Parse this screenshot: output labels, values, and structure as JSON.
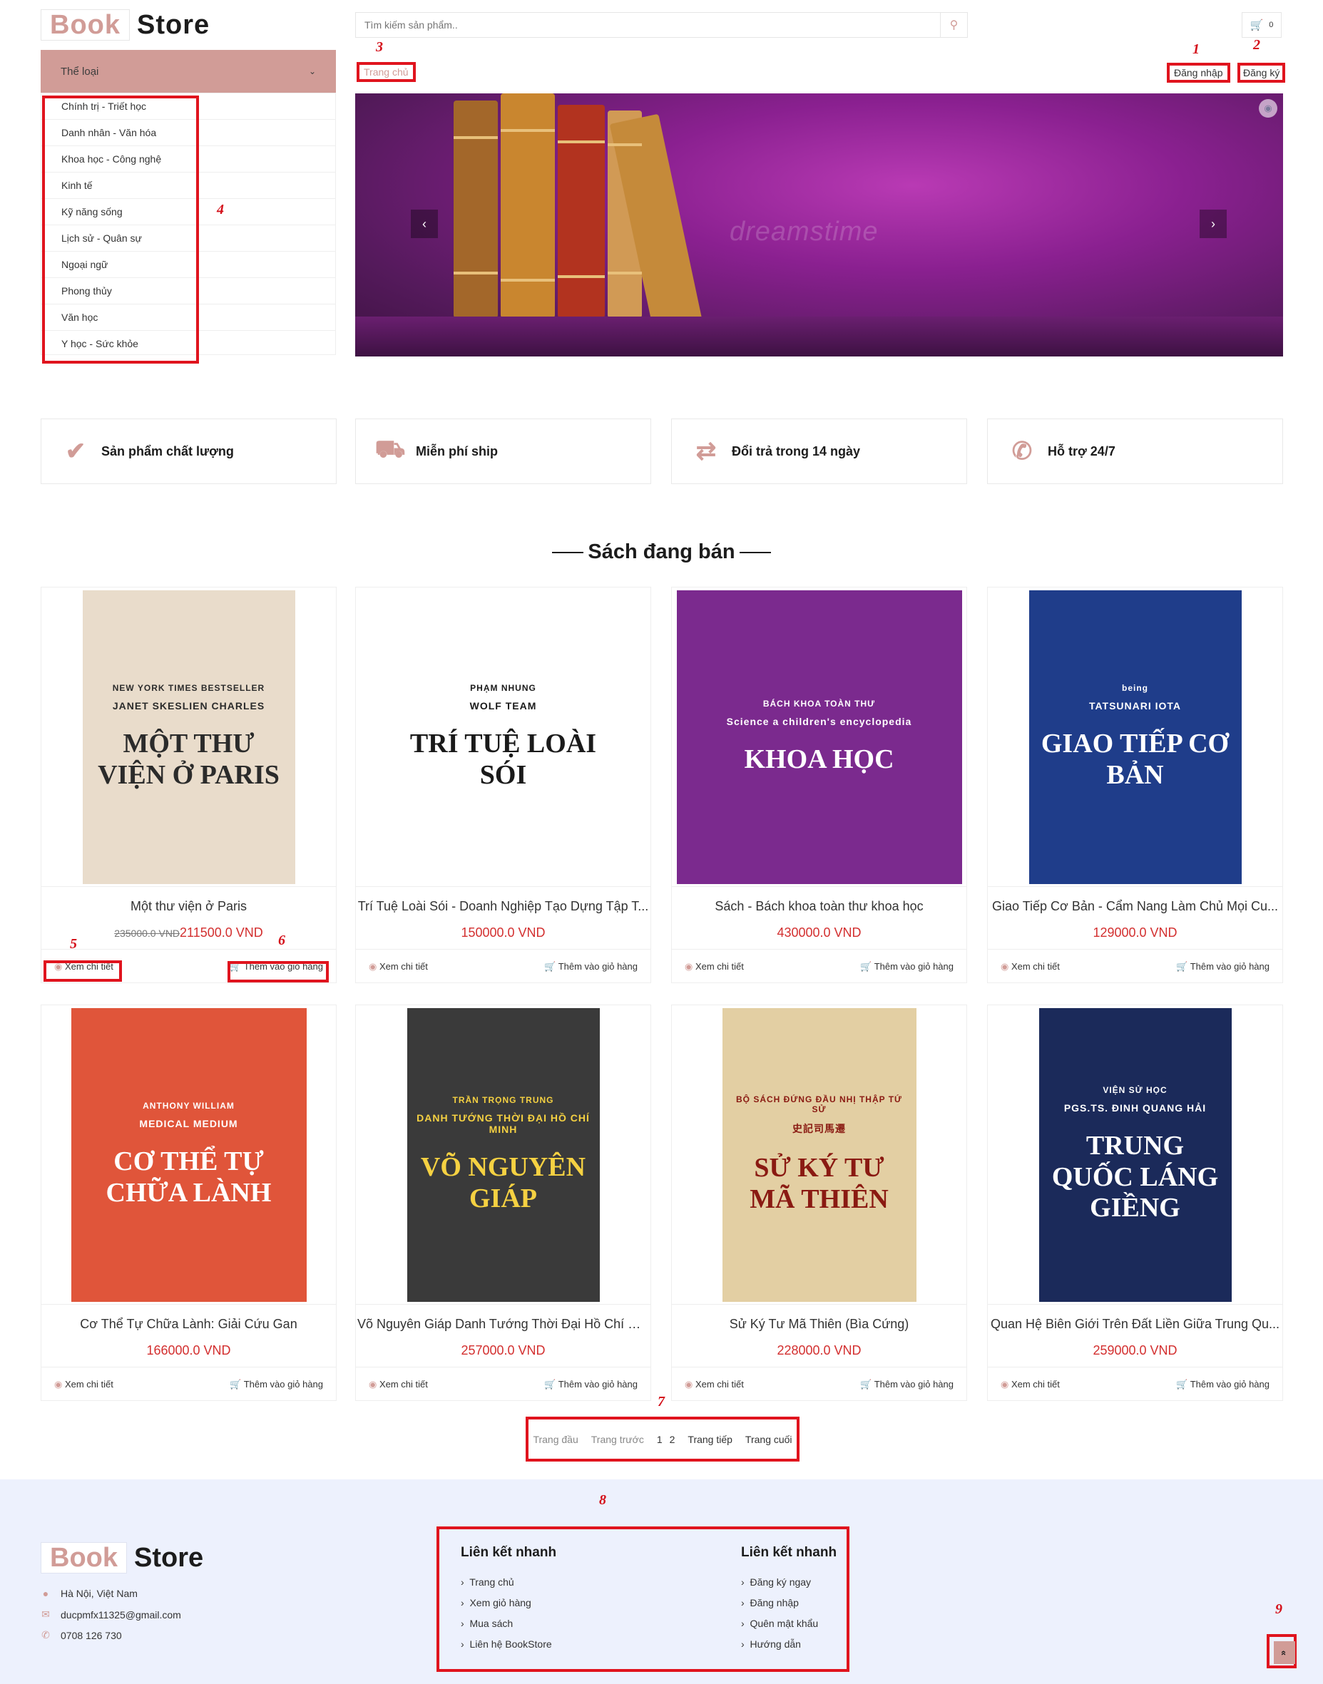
{
  "header": {
    "logo_part1": "Book",
    "logo_part2": "Store",
    "search_placeholder": "Tìm kiếm sản phẩm..",
    "search_icon": "search-icon",
    "cart_icon": "cart-icon",
    "cart_count": "0"
  },
  "annotation_marks": [
    "1",
    "2",
    "3",
    "4",
    "5",
    "6",
    "7",
    "8",
    "9"
  ],
  "categories": {
    "header": "Thể loại",
    "items": [
      "Chính trị - Triết học",
      "Danh nhân - Văn hóa",
      "Khoa học - Công nghệ",
      "Kinh tế",
      "Kỹ năng sống",
      "Lịch sử - Quân sự",
      "Ngoại ngữ",
      "Phong thủy",
      "Văn học",
      "Y học - Sức khỏe"
    ]
  },
  "nav": {
    "breadcrumb": "Trang chủ",
    "login": "Đăng nhập",
    "register": "Đăng ký"
  },
  "banner": {
    "watermark": "dreamstime",
    "prev": "‹",
    "next": "›"
  },
  "features": [
    {
      "icon": "check-icon",
      "label": "Sản phẩm chất lượng"
    },
    {
      "icon": "truck-icon",
      "label": "Miễn phí ship"
    },
    {
      "icon": "exchange-icon",
      "label": "Đổi trả trong 14 ngày"
    },
    {
      "icon": "phone-icon",
      "label": "Hỗ trợ 24/7"
    }
  ],
  "section_title": "Sách đang bán",
  "product_actions": {
    "details": "Xem chi tiết",
    "add_to_cart": "Thêm vào giỏ hàng"
  },
  "products": [
    {
      "title": "Một thư viện ở Paris",
      "old_price": "235000.0 VND",
      "price": "211500.0 VND",
      "cover_top": "NEW YORK TIMES BESTSELLER",
      "cover_author": "JANET SKESLIEN CHARLES",
      "cover_title": "MỘT THƯ VIỆN Ở PARIS",
      "cover_color": "#e9dccb",
      "cover_text_color": "#2b2b2b"
    },
    {
      "title": "Trí Tuệ Loài Sói - Doanh Nghiệp Tạo Dựng Tập T...",
      "old_price": "",
      "price": "150000.0 VND",
      "cover_top": "PHẠM NHUNG",
      "cover_author": "WOLF TEAM",
      "cover_title": "TRÍ TUỆ LOÀI SÓI",
      "cover_color": "#ffffff",
      "cover_text_color": "#1a1a1a"
    },
    {
      "title": "Sách - Bách khoa toàn thư khoa học",
      "old_price": "",
      "price": "430000.0 VND",
      "cover_top": "BÁCH KHOA TOÀN THƯ",
      "cover_author": "Science a children's encyclopedia",
      "cover_title": "KHOA HỌC",
      "cover_color": "#7b2a8e",
      "cover_text_color": "#ffffff"
    },
    {
      "title": "Giao Tiếp Cơ Bản - Cẩm Nang Làm Chủ Mọi Cu...",
      "old_price": "",
      "price": "129000.0 VND",
      "cover_top": "being",
      "cover_author": "TATSUNARI IOTA",
      "cover_title": "GIAO TIẾP CƠ BẢN",
      "cover_color": "#1f3d8a",
      "cover_text_color": "#ffffff"
    },
    {
      "title": "Cơ Thể Tự Chữa Lành: Giải Cứu Gan",
      "old_price": "",
      "price": "166000.0 VND",
      "cover_top": "ANTHONY WILLIAM",
      "cover_author": "MEDICAL MEDIUM",
      "cover_title": "CƠ THỂ TỰ CHỮA LÀNH",
      "cover_color": "#e0553a",
      "cover_text_color": "#ffffff"
    },
    {
      "title": "Võ Nguyên Giáp Danh Tướng Thời Đại Hồ Chí M...",
      "old_price": "",
      "price": "257000.0 VND",
      "cover_top": "TRẦN TRỌNG TRUNG",
      "cover_author": "DANH TƯỚNG THỜI ĐẠI HỒ CHÍ MINH",
      "cover_title": "VÕ NGUYÊN GIÁP",
      "cover_color": "#3a3a3a",
      "cover_text_color": "#f5d142"
    },
    {
      "title": "Sử Ký Tư Mã Thiên (Bìa Cứng)",
      "old_price": "",
      "price": "228000.0 VND",
      "cover_top": "BỘ SÁCH ĐỨNG ĐẦU NHỊ THẬP TỨ SỬ",
      "cover_author": "史記司馬遷",
      "cover_title": "SỬ KÝ TƯ MÃ THIÊN",
      "cover_color": "#e3cfa3",
      "cover_text_color": "#8a1a12"
    },
    {
      "title": "Quan Hệ Biên Giới Trên Đất Liền Giữa Trung Qu...",
      "old_price": "",
      "price": "259000.0 VND",
      "cover_top": "VIỆN SỬ HỌC",
      "cover_author": "PGS.TS. ĐINH QUANG HẢI",
      "cover_title": "TRUNG QUỐC LÁNG GIỀNG",
      "cover_color": "#1b2a5a",
      "cover_text_color": "#ffffff"
    }
  ],
  "pagination": {
    "first": "Trang đầu",
    "prev": "Trang trước",
    "page1": "1",
    "page2": "2",
    "next": "Trang tiếp",
    "last": "Trang cuối"
  },
  "footer": {
    "logo_part1": "Book",
    "logo_part2": "Store",
    "address": "Hà Nội, Việt Nam",
    "email": "ducpmfx11325@gmail.com",
    "phone": "0708 126 730",
    "col1": {
      "title": "Liên kết nhanh",
      "items": [
        "Trang chủ",
        "Xem giỏ hàng",
        "Mua sách",
        "Liên hệ BookStore"
      ]
    },
    "col2": {
      "title": "Liên kết nhanh",
      "items": [
        "Đăng ký ngay",
        "Đăng nhập",
        "Quên mật khẩu",
        "Hướng dẫn"
      ]
    },
    "back_to_top": "«"
  },
  "colors": {
    "accent": "#d19c97",
    "price": "#d32f2f",
    "annotation": "#e0141e",
    "footer_bg": "#edf1fd"
  }
}
